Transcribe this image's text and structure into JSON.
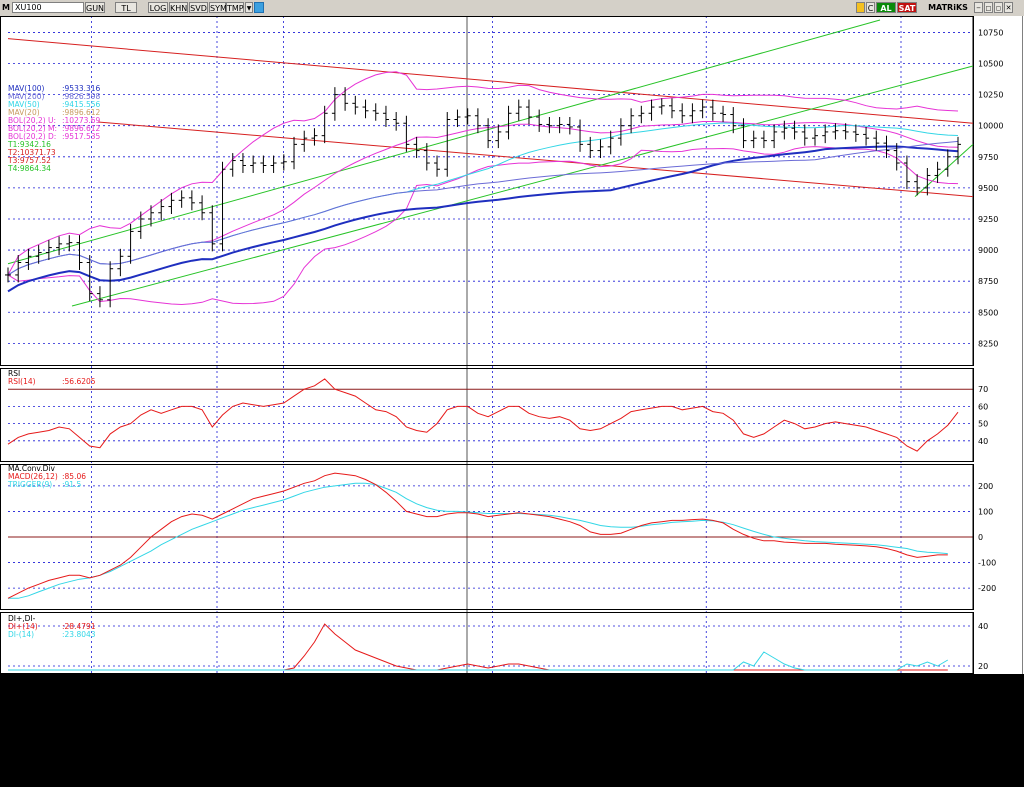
{
  "toolbar": {
    "m_label": "M",
    "symbol": "XU100",
    "buttons": [
      "GUN",
      "TL",
      "LOG",
      "KHN",
      "SVD",
      "SYM",
      "TMP"
    ],
    "buy_label": "AL",
    "sell_label": "SAT",
    "matrix_label": "MATRiKS",
    "c_label": "C"
  },
  "colors": {
    "price_bars": "#000000",
    "mav100": "#1f2fbf",
    "mav200": "#6b6bd6",
    "mav50": "#33d6e6",
    "mav20": "#d9b48a",
    "bollinger": "#e633d6",
    "trend_red": "#d62020",
    "trend_green": "#27c327",
    "rsi": "#e61a1a",
    "macd": "#e61a1a",
    "trigger": "#33d6e6",
    "di_plus": "#e61a1a",
    "di_minus": "#33d6e6",
    "level_line": "#8b1a1a"
  },
  "price_panel": {
    "legend": [
      {
        "label": "MAV(100)",
        "value": ":9533.316",
        "color": "#1f2fbf"
      },
      {
        "label": "MAV(200)",
        "value": ":9826.598",
        "color": "#6b6bd6"
      },
      {
        "label": "MAV(50)",
        "value": ":9415.556",
        "color": "#33d6e6"
      },
      {
        "label": "MAV(20)",
        "value": ":9896.612",
        "color": "#d9b48a"
      },
      {
        "label": "BOL(20,2) U:",
        "value": ":10273.69",
        "color": "#e633d6"
      },
      {
        "label": "BOL(20,2) M:",
        "value": ":9896.612",
        "color": "#e633d6"
      },
      {
        "label": "BOL(20,2) D:",
        "value": ":9517.535",
        "color": "#e633d6"
      },
      {
        "label": "T1:9342.16",
        "value": "",
        "color": "#27c327"
      },
      {
        "label": "T2:10371.73",
        "value": "",
        "color": "#d62020"
      },
      {
        "label": "T3:9757.52",
        "value": "",
        "color": "#d62020"
      },
      {
        "label": "T4:9864.34",
        "value": "",
        "color": "#27c327"
      }
    ],
    "yticks": [
      "10750",
      "10500",
      "10250",
      "10000",
      "9750",
      "9500",
      "9250",
      "9000",
      "8750",
      "8500",
      "8250"
    ]
  },
  "rsi_panel": {
    "title": "RSI",
    "legend": "RSI(14)",
    "value": ":56.6205",
    "yticks": [
      "70",
      "60",
      "50",
      "40"
    ]
  },
  "macd_panel": {
    "title": "MA.Conv.Div",
    "legend_macd": "MACD(26,12)",
    "value_macd": ":85.06",
    "legend_trigger": "TRIGGER(9)",
    "value_trigger": ":91.5",
    "yticks": [
      "200",
      "100",
      "0",
      "-100",
      "-200"
    ]
  },
  "di_panel": {
    "title": "DI+,DI-",
    "legend_plus": "DI+(14)",
    "value_plus": ":28.4791",
    "legend_minus": "DI-(14)",
    "value_minus": ":23.8043",
    "yticks": [
      "40",
      "20"
    ]
  },
  "chart_data": {
    "type": "line",
    "title": "XU100",
    "price": {
      "ylim": [
        8100,
        10850
      ],
      "close": [
        8800,
        8900,
        8950,
        8980,
        9020,
        9050,
        9060,
        8900,
        8650,
        8600,
        8850,
        8950,
        9150,
        9250,
        9300,
        9350,
        9400,
        9420,
        9380,
        9300,
        9050,
        9650,
        9720,
        9680,
        9700,
        9680,
        9700,
        9710,
        9850,
        9900,
        9920,
        10100,
        10250,
        10180,
        10150,
        10120,
        10100,
        10050,
        10020,
        9850,
        9800,
        9700,
        9650,
        10050,
        10070,
        10080,
        10000,
        9880,
        9950,
        10100,
        10150,
        10070,
        10010,
        10000,
        10010,
        9990,
        9850,
        9800,
        9830,
        9900,
        10000,
        10080,
        10100,
        10150,
        10160,
        10120,
        10080,
        10120,
        10150,
        10100,
        10090,
        10000,
        9880,
        9900,
        9880,
        9950,
        9980,
        9950,
        9900,
        9920,
        9950,
        9960,
        9950,
        9930,
        9900,
        9860,
        9800,
        9700,
        9550,
        9500,
        9600,
        9650,
        9750,
        9850
      ]
    },
    "rsi": {
      "ylim": [
        30,
        80
      ],
      "values": [
        38,
        42,
        44,
        45,
        46,
        48,
        47,
        42,
        37,
        36,
        44,
        48,
        50,
        55,
        58,
        56,
        58,
        60,
        60,
        58,
        48,
        55,
        60,
        62,
        61,
        60,
        61,
        62,
        66,
        70,
        72,
        76,
        70,
        68,
        66,
        62,
        58,
        57,
        54,
        48,
        46,
        45,
        50,
        58,
        60,
        60,
        56,
        54,
        57,
        60,
        60,
        56,
        54,
        53,
        54,
        52,
        47,
        46,
        47,
        50,
        53,
        57,
        58,
        59,
        60,
        60,
        58,
        59,
        60,
        57,
        56,
        52,
        44,
        42,
        44,
        48,
        52,
        50,
        47,
        48,
        50,
        51,
        50,
        49,
        48,
        46,
        44,
        42,
        37,
        34,
        40,
        44,
        49,
        56.6205
      ]
    },
    "macd": {
      "ylim": [
        -270,
        270
      ],
      "macd": [
        -240,
        -220,
        -200,
        -185,
        -170,
        -160,
        -150,
        -150,
        -160,
        -150,
        -130,
        -110,
        -80,
        -40,
        0,
        30,
        60,
        80,
        90,
        85,
        70,
        90,
        110,
        130,
        150,
        160,
        170,
        180,
        195,
        210,
        220,
        240,
        250,
        245,
        240,
        225,
        205,
        175,
        140,
        100,
        90,
        80,
        80,
        90,
        95,
        95,
        90,
        80,
        85,
        90,
        95,
        90,
        85,
        80,
        70,
        60,
        45,
        20,
        10,
        10,
        15,
        30,
        45,
        55,
        60,
        65,
        65,
        68,
        70,
        65,
        55,
        30,
        10,
        -5,
        -15,
        -15,
        -20,
        -22,
        -25,
        -25,
        -25,
        -28,
        -30,
        -32,
        -35,
        -38,
        -45,
        -55,
        -70,
        -80,
        -75,
        -70,
        -70,
        85.06
      ],
      "trigger": [
        -240,
        -240,
        -230,
        -215,
        -200,
        -185,
        -175,
        -165,
        -160,
        -150,
        -135,
        -115,
        -95,
        -75,
        -55,
        -30,
        -10,
        10,
        30,
        45,
        60,
        75,
        90,
        105,
        115,
        125,
        135,
        145,
        160,
        175,
        185,
        195,
        200,
        205,
        210,
        210,
        205,
        190,
        175,
        150,
        130,
        115,
        105,
        100,
        100,
        98,
        95,
        92,
        92,
        92,
        92,
        90,
        88,
        85,
        80,
        72,
        65,
        55,
        45,
        40,
        38,
        38,
        42,
        48,
        52,
        57,
        60,
        62,
        65,
        63,
        58,
        48,
        35,
        22,
        10,
        0,
        -5,
        -10,
        -15,
        -18,
        -20,
        -22,
        -24,
        -26,
        -28,
        -30,
        -35,
        -40,
        -45,
        -55,
        -60,
        -62,
        -65,
        91.5
      ]
    },
    "di": {
      "ylim": [
        18,
        45
      ],
      "di_plus": [
        18,
        18,
        18,
        18,
        18,
        18,
        18,
        18,
        18,
        18,
        18,
        18,
        18,
        18,
        18,
        18,
        18,
        18,
        18,
        18,
        18,
        18,
        18,
        18,
        18,
        18,
        18,
        18,
        19,
        25,
        32,
        41,
        36,
        32,
        28,
        26,
        24,
        22,
        20,
        19,
        18,
        18,
        18,
        19,
        20,
        21,
        20,
        19,
        20,
        21,
        21,
        20,
        19,
        18,
        18,
        18,
        18,
        18,
        18,
        18,
        18,
        18,
        18,
        18,
        18,
        18,
        18,
        18,
        18,
        18,
        18,
        18,
        18,
        18,
        18,
        18,
        18,
        18,
        18,
        18,
        18,
        18,
        18,
        18,
        18,
        18,
        18,
        18,
        18,
        18,
        18,
        18,
        18,
        28.4791
      ],
      "di_minus": [
        18,
        18,
        18,
        18,
        18,
        18,
        18,
        18,
        18,
        18,
        18,
        18,
        18,
        18,
        18,
        18,
        18,
        18,
        18,
        18,
        18,
        18,
        18,
        18,
        18,
        18,
        18,
        18,
        18,
        18,
        18,
        18,
        18,
        18,
        18,
        18,
        18,
        18,
        18,
        18,
        18,
        18,
        18,
        18,
        18,
        18,
        18,
        18,
        18,
        18,
        18,
        18,
        18,
        18,
        18,
        18,
        18,
        18,
        18,
        18,
        18,
        18,
        18,
        18,
        18,
        18,
        18,
        18,
        18,
        18,
        18,
        18,
        22,
        20,
        27,
        24,
        21,
        19,
        18,
        18,
        18,
        18,
        18,
        18,
        18,
        18,
        18,
        18,
        21,
        20,
        22,
        20,
        23,
        23.8043
      ]
    }
  }
}
